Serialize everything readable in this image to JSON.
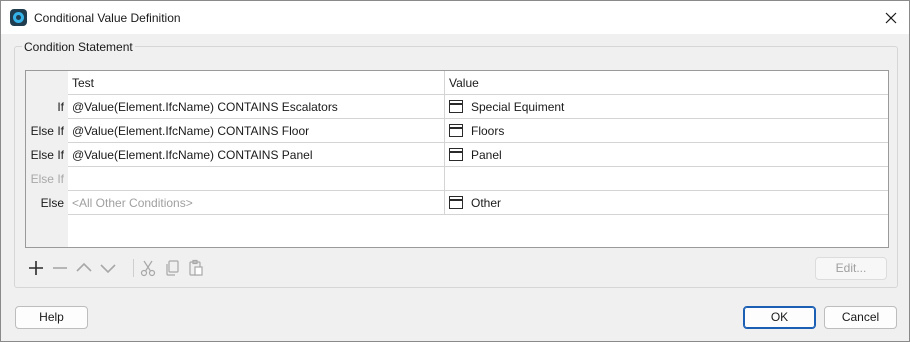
{
  "window": {
    "title": "Conditional Value Definition",
    "icon": "app-icon",
    "close_icon": "close-icon"
  },
  "group": {
    "label": "Condition Statement"
  },
  "grid": {
    "columns": [
      "Test",
      "Value"
    ],
    "rows": [
      {
        "label": "If",
        "test": "@Value(Element.IfcName) CONTAINS Escalators",
        "value": "Special Equiment",
        "has_icon": true,
        "label_disabled": false,
        "test_placeholder": false
      },
      {
        "label": "Else If",
        "test": "@Value(Element.IfcName) CONTAINS Floor",
        "value": "Floors",
        "has_icon": true,
        "label_disabled": false,
        "test_placeholder": false
      },
      {
        "label": "Else If",
        "test": "@Value(Element.IfcName) CONTAINS Panel",
        "value": "Panel",
        "has_icon": true,
        "label_disabled": false,
        "test_placeholder": false
      },
      {
        "label": "Else If",
        "test": "",
        "value": "",
        "has_icon": false,
        "label_disabled": true,
        "test_placeholder": false
      },
      {
        "label": "Else",
        "test": "<All Other Conditions>",
        "value": "Other",
        "has_icon": true,
        "label_disabled": false,
        "test_placeholder": true
      }
    ]
  },
  "toolbar": {
    "buttons": [
      "add-icon",
      "remove-icon",
      "move-up-icon",
      "move-down-icon",
      "cut-icon",
      "copy-icon",
      "paste-icon"
    ],
    "edit_label": "Edit..."
  },
  "footer": {
    "help_label": "Help",
    "ok_label": "OK",
    "cancel_label": "Cancel"
  },
  "colors": {
    "accent": "#1a5fb4",
    "app_icon_bg": "#1f3d4f",
    "app_icon_ring": "#36b3e8"
  }
}
